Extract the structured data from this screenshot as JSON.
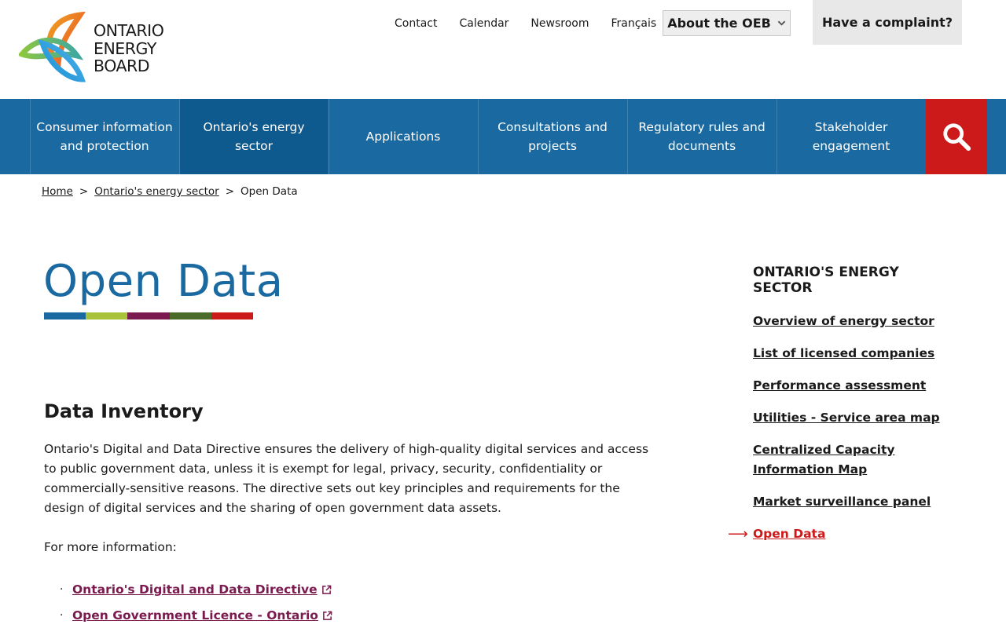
{
  "header": {
    "logo_lines": [
      "ONTARIO",
      "ENERGY",
      "BOARD"
    ],
    "utility_links": [
      "Contact",
      "Calendar",
      "Newsroom",
      "Français"
    ],
    "about_label": "About the OEB",
    "complaint_label": "Have a complaint?"
  },
  "nav": {
    "items": [
      "Consumer information and protection",
      "Ontario's energy sector",
      "Applications",
      "Consultations and projects",
      "Regulatory rules and documents",
      "Stakeholder engagement"
    ],
    "active_index": 1
  },
  "breadcrumb": {
    "home": "Home",
    "sector": "Ontario's energy sector",
    "current": "Open Data",
    "separator": ">"
  },
  "page": {
    "title": "Open Data",
    "bar_colors": [
      "#1a6aa1",
      "#a8c23a",
      "#7a1a4e",
      "#4a6b2a",
      "#cc1a1a"
    ]
  },
  "content": {
    "heading": "Data Inventory",
    "paragraph": "Ontario's Digital and Data Directive ensures the delivery of high-quality digital services and access to public government data, unless it is exempt for legal, privacy, security, confidentiality or commercially-sensitive reasons. The directive sets out key principles and requirements for the design of digital services and the sharing of open government data assets.",
    "more_info": "For more information:",
    "links": [
      "Ontario's Digital and Data Directive",
      "Open Government Licence - Ontario"
    ]
  },
  "sidenav": {
    "heading": "ONTARIO'S ENERGY SECTOR",
    "items": [
      "Overview of energy sector",
      "List of licensed companies",
      "Performance assessment",
      "Utilities - Service area map",
      "Centralized Capacity Information Map",
      "Market surveillance panel",
      "Open Data"
    ],
    "arrow": "⟶"
  },
  "colors": {
    "brand_blue": "#1a6aa1",
    "search_red": "#cc1a1a",
    "link_plum": "#7a1a4e"
  }
}
